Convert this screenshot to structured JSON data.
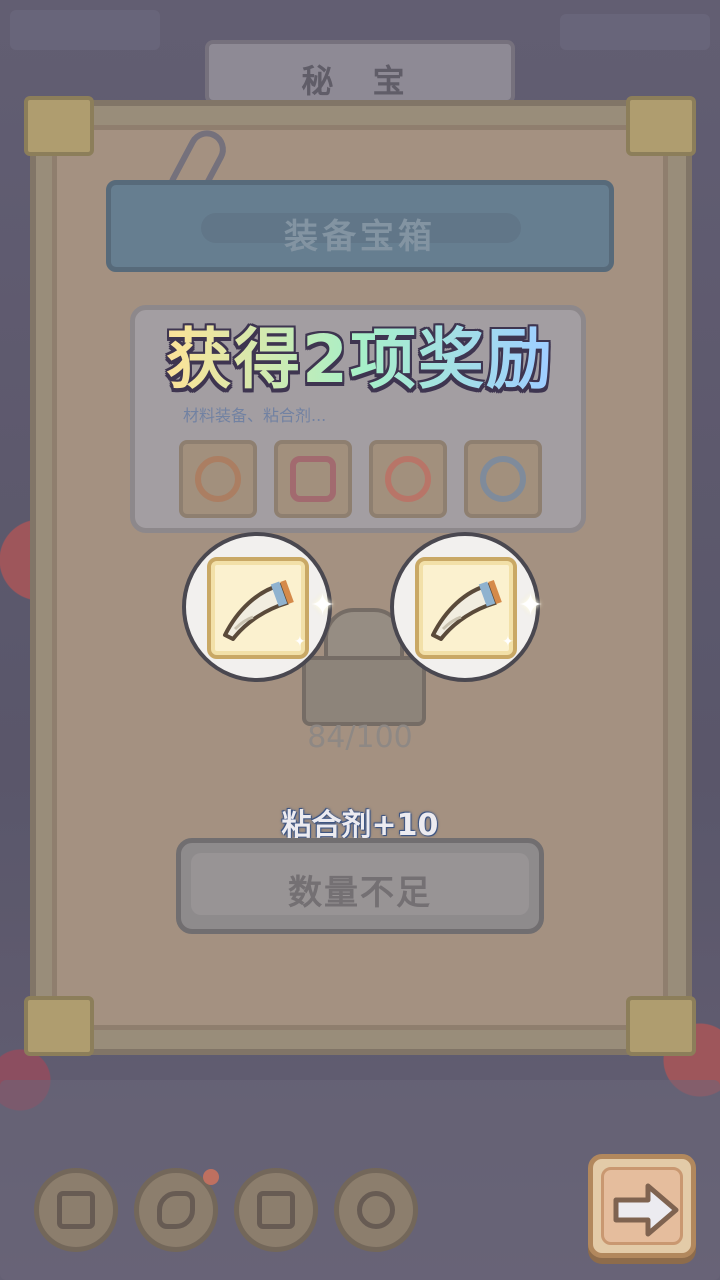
{
  "screen": {
    "top_title": "秘 宝",
    "chest": {
      "title": "装备宝箱",
      "description": "材料装备、粘合剂...",
      "slots": [
        "ring-icon",
        "tag-icon",
        "amulet-icon",
        "bracelet-icon"
      ],
      "progress": "84/100"
    },
    "reward_toast": "粘合剂+10",
    "action_button_label": "数量不足",
    "nav_items": [
      "map-icon",
      "flashlight-icon",
      "treasure-chest-icon",
      "mask-icon"
    ],
    "next_button_icon": "arrow-right-icon"
  },
  "popup": {
    "heading": "获得2项奖励",
    "rewards": [
      {
        "icon": "horn-icon"
      },
      {
        "icon": "horn-icon"
      }
    ]
  },
  "colors": {
    "accent_next": "#f7c79a",
    "toast_text": "#ffffff",
    "heading_gradient": [
      "#f6a7c8",
      "#f8e49a",
      "#a7f0c8",
      "#9fd0ff",
      "#d7a8ff"
    ]
  }
}
